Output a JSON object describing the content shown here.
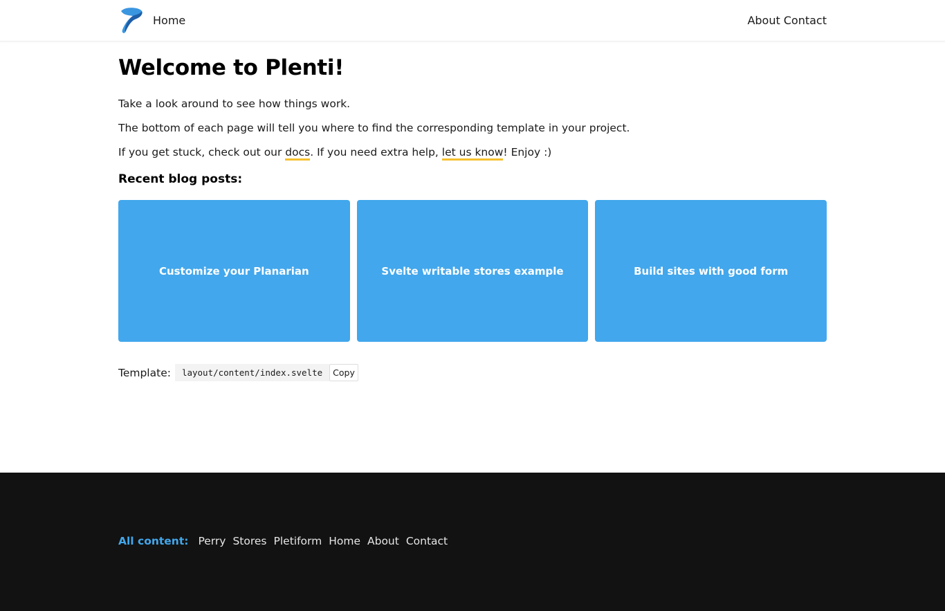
{
  "header": {
    "home_label": "Home",
    "nav": [
      "About",
      "Contact"
    ]
  },
  "main": {
    "title": "Welcome to Plenti!",
    "paragraphs": {
      "p1": "Take a look around to see how things work.",
      "p2": "The bottom of each page will tell you where to find the corresponding template in your project.",
      "p3_before": "If you get stuck, check out our ",
      "p3_link1": "docs",
      "p3_middle": ". If you need extra help, ",
      "p3_link2": "let us know",
      "p3_after": "! Enjoy :)"
    },
    "recent_heading": "Recent blog posts:",
    "cards": [
      "Customize your Planarian",
      "Svelte writable stores example",
      "Build sites with good form"
    ],
    "template_label": "Template:",
    "template_path": "layout/content/index.svelte",
    "copy_label": "Copy"
  },
  "footer": {
    "label": "All content:",
    "links": [
      "Perry",
      "Stores",
      "Pletiform",
      "Home",
      "About",
      "Contact"
    ]
  },
  "colors": {
    "accent": "#42a7ec",
    "highlight": "#f6c02d",
    "footer_bg": "#121212"
  }
}
